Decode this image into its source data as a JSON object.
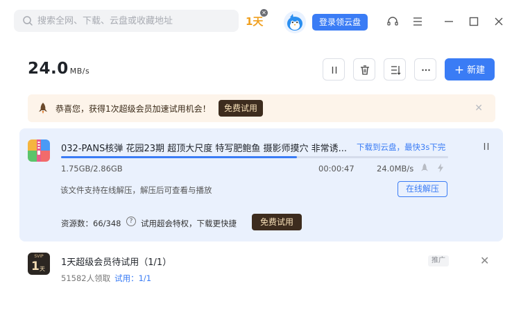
{
  "header": {
    "search_placeholder": "搜索全网、下载、云盘或收藏地址",
    "trial_badge": "1天",
    "login_button": "登录领云盘"
  },
  "speed": {
    "value": "24.0",
    "unit": "MB/s"
  },
  "toolbar": {
    "new_button": "新建"
  },
  "banner": {
    "message": "恭喜您，获得1次超级会员加速试用机会！",
    "free_trial_button": "免费试用"
  },
  "task": {
    "file_name": "032-PANS核弹 花园23期 超顶大尺度 特写肥鲍鱼 摄影师摸穴 非常诱...",
    "cloud_link": "下载到云盘，最快3s下完",
    "progress": 0.61,
    "size": "1.75GB/2.86GB",
    "time_left": "00:00:47",
    "speed": "24.0MB/s",
    "hint": "该文件支持在线解压，解压后可查看与播放",
    "online_unzip_button": "在线解压",
    "sources": "资源数：66/348",
    "privilege_text": "试用超会特权，下载更快捷",
    "free_trial_button": "免费试用"
  },
  "promo": {
    "icon_text_top": "SVIP",
    "icon_text_main": "1",
    "icon_text_unit": "天",
    "title": "1天超级会员待试用（1/1）",
    "claimed": "51582人领取",
    "trial_ratio": "试用：1/1",
    "ad_tag": "推广"
  },
  "colors": {
    "accent": "#3a7cf5",
    "card_bg": "#eaf1fd",
    "banner_bg": "#fdf4ea",
    "vip_button": "#3d2c1e"
  }
}
